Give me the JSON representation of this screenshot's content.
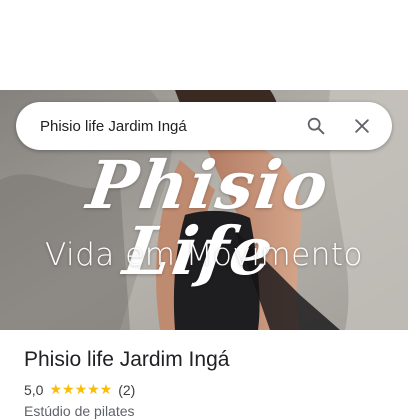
{
  "search": {
    "value": "Phisio life Jardim Ingá",
    "placeholder": ""
  },
  "hero": {
    "logo_script": "Phisio Life",
    "tagline": "Vida em Movimento"
  },
  "place": {
    "name": "Phisio life Jardim Ingá",
    "rating": "5,0",
    "stars": "★★★★★",
    "review_count": "(2)",
    "category": "Estúdio de pilates"
  },
  "icons": {
    "search": "search-icon",
    "close": "close-icon"
  },
  "colors": {
    "star": "#fbbc04",
    "title": "#202124",
    "muted": "#5f6368",
    "icon": "#5f6368"
  }
}
